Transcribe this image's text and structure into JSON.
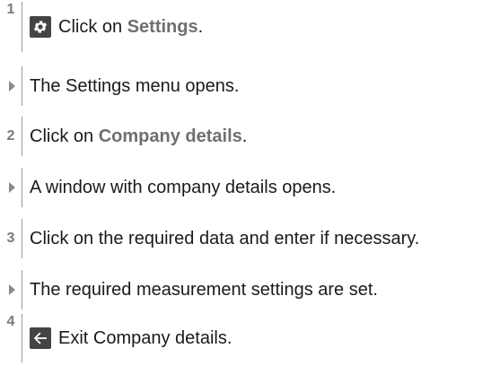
{
  "steps": [
    {
      "type": "step",
      "marker": "1",
      "icon": "gear-icon",
      "pre": "Click on ",
      "highlight": "Settings",
      "post": "."
    },
    {
      "type": "result",
      "text": "The Settings menu opens."
    },
    {
      "type": "step",
      "marker": "2",
      "pre": "Click on ",
      "highlight": "Company details",
      "post": "."
    },
    {
      "type": "result",
      "text": "A window with company details opens."
    },
    {
      "type": "step",
      "marker": "3",
      "text": "Click on the required data and enter if necessary."
    },
    {
      "type": "result",
      "text": "The required measurement settings are set."
    },
    {
      "type": "step",
      "marker": "4",
      "icon": "back-arrow-icon",
      "text": "Exit Company details."
    }
  ]
}
